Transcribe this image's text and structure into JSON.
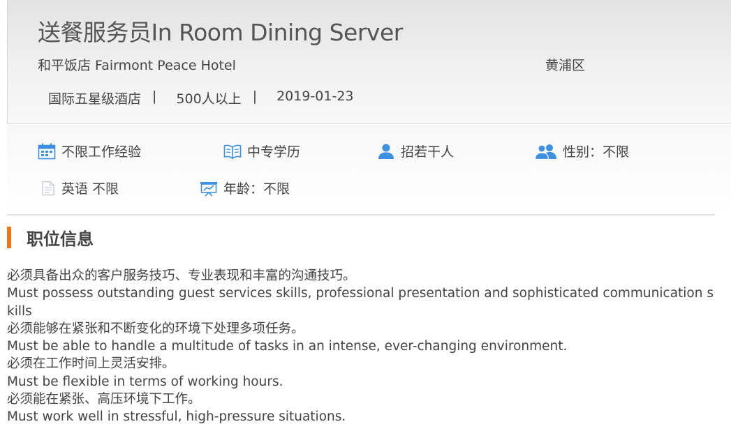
{
  "job": {
    "title": "送餐服务员In Room Dining Server",
    "company": "和平饭店 Fairmont Peace Hotel",
    "district": "黄浦区",
    "company_type": "国际五星级酒店",
    "company_size": "500人以上",
    "date": "2019-01-23",
    "separator": "|"
  },
  "requirements": [
    {
      "label": "不限工作经验",
      "icon": "calendar-icon"
    },
    {
      "label": "中专学历",
      "icon": "book-icon"
    },
    {
      "label": "招若干人",
      "icon": "person-icon"
    },
    {
      "label": "性别：不限",
      "icon": "people-icon"
    },
    {
      "label": "英语 不限",
      "icon": "document-icon"
    },
    {
      "label": "年龄：不限",
      "icon": "presentation-icon"
    }
  ],
  "section": {
    "title": "职位信息"
  },
  "description": [
    "必须具备出众的客户服务技巧、专业表现和丰富的沟通技巧。",
    "Must possess outstanding guest services skills, professional presentation and sophisticated communication skills",
    "必须能够在紧张和不断变化的环境下处理多项任务。",
    "Must be able to handle a multitude of tasks in an intense, ever-changing environment.",
    "必须在工作时间上灵活安排。",
    "Must be flexible in terms of working hours.",
    "必须能在紧张、高压环境下工作。",
    "Must work well in stressful, high-pressure situations."
  ],
  "colors": {
    "accent": "#f0761a",
    "icon_blue": "#3d8fe0",
    "text": "#444444"
  }
}
